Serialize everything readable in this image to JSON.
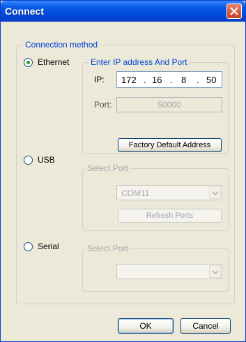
{
  "window": {
    "title": "Connect"
  },
  "connection_group": {
    "legend": "Connection method"
  },
  "options": {
    "ethernet": {
      "label": "Ethernet",
      "selected": true
    },
    "usb": {
      "label": "USB",
      "selected": false
    },
    "serial": {
      "label": "Serial",
      "selected": false
    }
  },
  "ethernet_group": {
    "legend": "Enter IP address And Port",
    "ip_label": "IP:",
    "ip_octets": [
      "172",
      "16",
      "8",
      "50"
    ],
    "ip_separator": ".",
    "port_label": "Port:",
    "port_value": "50000",
    "factory_button": "Factory Default Address"
  },
  "usb_group": {
    "legend": "Select Port",
    "port_selected": "COM11",
    "refresh_button": "Refresh Ports"
  },
  "serial_group": {
    "legend": "Select Port",
    "port_selected": ""
  },
  "footer": {
    "ok_label": "OK",
    "cancel_label": "Cancel"
  },
  "colors": {
    "title_bar": "#0a5be8",
    "dialog_bg": "#ece9d8",
    "accent_text": "#0046d5",
    "radio_dot": "#21a121",
    "disabled_text": "#a7a6aa"
  },
  "icons": {
    "close": "close-icon",
    "dropdown": "chevron-down-icon"
  }
}
